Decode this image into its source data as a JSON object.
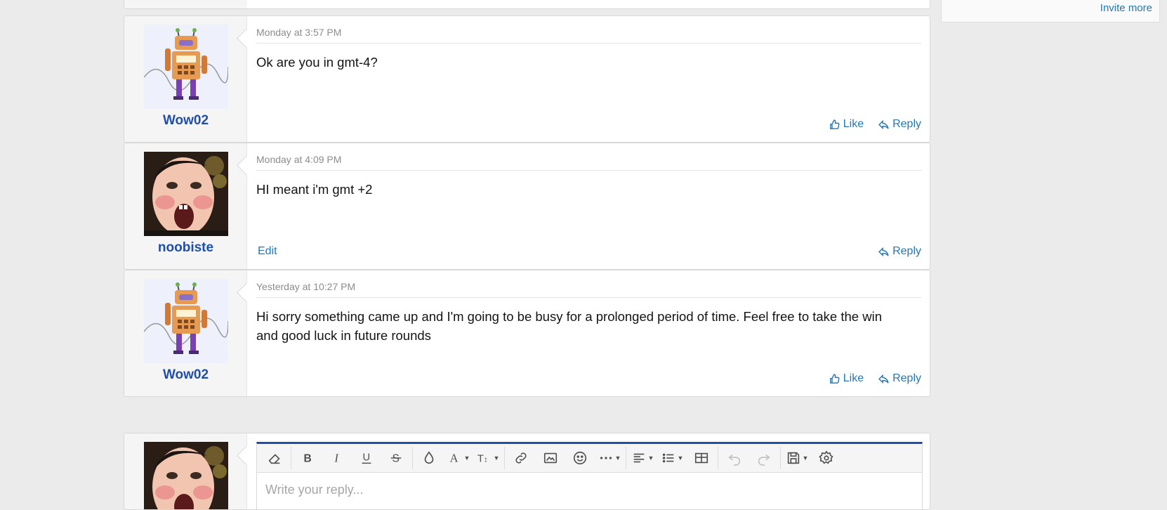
{
  "sidebar": {
    "invite_more": "Invite more"
  },
  "messages": [
    {
      "username": "Wow02",
      "avatar": "robot-avatar",
      "timestamp": "Monday at 3:57 PM",
      "text": "Ok are you in gmt-4?",
      "actions": {
        "like": "Like",
        "reply": "Reply"
      }
    },
    {
      "username": "noobiste",
      "avatar": "face-avatar",
      "timestamp": "Monday at 4:09 PM",
      "text": "HI meant i'm gmt +2",
      "actions": {
        "edit": "Edit",
        "reply": "Reply"
      }
    },
    {
      "username": "Wow02",
      "avatar": "robot-avatar",
      "timestamp": "Yesterday at 10:27 PM",
      "text": "Hi sorry something came up and I'm going to be busy for a prolonged period of time. Feel free to take the win and good luck in future rounds",
      "actions": {
        "like": "Like",
        "reply": "Reply"
      }
    }
  ],
  "reply": {
    "avatar": "face-avatar",
    "placeholder": "Write your reply..."
  },
  "toolbar_icons": [
    "eraser-icon",
    "bold-icon",
    "italic-icon",
    "underline-icon",
    "strikethrough-icon",
    "text-color-icon",
    "font-family-icon",
    "font-size-icon",
    "link-icon",
    "image-icon",
    "emoji-icon",
    "more-icon",
    "align-icon",
    "list-icon",
    "table-icon",
    "undo-icon",
    "redo-icon",
    "drafts-icon",
    "settings-icon"
  ],
  "colors": {
    "link": "#2577b1",
    "username": "#1f4fa8",
    "editor_accent": "#1f4fa8",
    "page_bg": "#ebebeb"
  }
}
